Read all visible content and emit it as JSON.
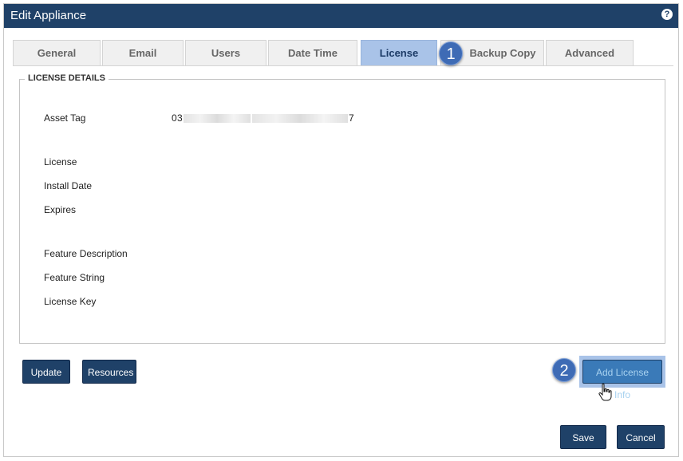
{
  "dialog": {
    "title": "Edit Appliance",
    "help_label": "?"
  },
  "tabs": [
    {
      "label": "General",
      "active": false
    },
    {
      "label": "Email",
      "active": false
    },
    {
      "label": "Users",
      "active": false
    },
    {
      "label": "Date Time",
      "active": false
    },
    {
      "label": "License",
      "active": true
    },
    {
      "label": "Backup Copy",
      "active": false
    },
    {
      "label": "Advanced",
      "active": false
    }
  ],
  "annotations": {
    "step1": "1",
    "step2": "2"
  },
  "license_details": {
    "legend": "LICENSE DETAILS",
    "asset_tag_label": "Asset Tag",
    "asset_tag_value_start": "03",
    "asset_tag_value_end": "7",
    "license_label": "License",
    "install_date_label": "Install Date",
    "expires_label": "Expires",
    "feature_description_label": "Feature Description",
    "feature_string_label": "Feature String",
    "license_key_label": "License Key"
  },
  "buttons": {
    "update": "Update",
    "resources": "Resources",
    "add_license_info": "Add License Info",
    "save": "Save",
    "cancel": "Cancel"
  },
  "colors": {
    "header": "#1f4168",
    "active_tab": "#a9c3e8",
    "badge": "#3e6bb5"
  }
}
